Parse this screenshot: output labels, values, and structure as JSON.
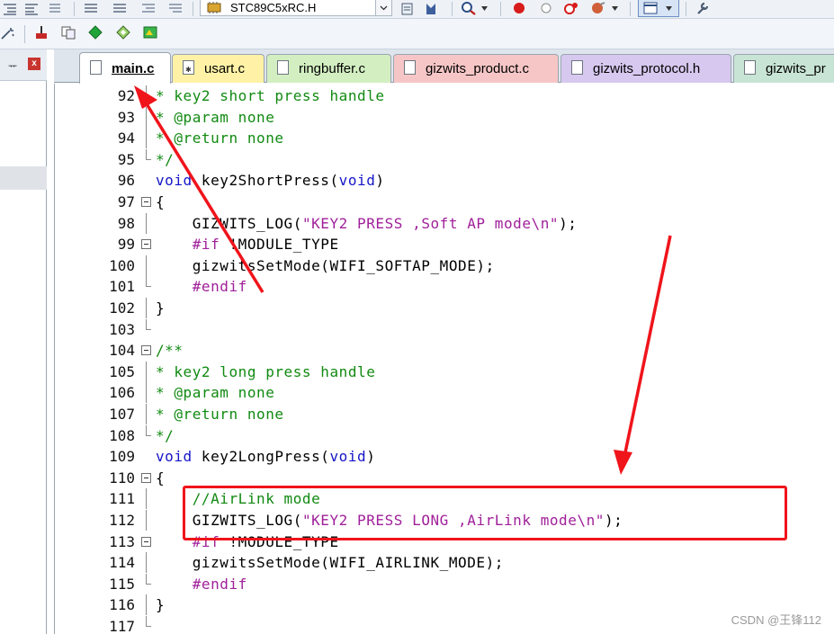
{
  "toolbar": {
    "device": "STC89C5xRC.H"
  },
  "left_panel": {
    "pin_glyph": "ᅲ",
    "close_glyph": "x"
  },
  "tabs": [
    {
      "id": "tab-main",
      "label": "main.c",
      "active": true
    },
    {
      "id": "tab-usart",
      "label": "usart.c",
      "active": false
    },
    {
      "id": "tab-ring",
      "label": "ringbuffer.c",
      "active": false
    },
    {
      "id": "tab-product",
      "label": "gizwits_product.c",
      "active": false
    },
    {
      "id": "tab-protocol",
      "label": "gizwits_protocol.h",
      "active": false
    },
    {
      "id": "tab-gizpr",
      "label": "gizwits_pr",
      "active": false
    }
  ],
  "code_lines": [
    {
      "num": "92",
      "fold": "line",
      "segments": [
        {
          "t": "* key2 short press handle",
          "c": "comment"
        }
      ]
    },
    {
      "num": "93",
      "fold": "line",
      "segments": [
        {
          "t": "* @param none",
          "c": "comment"
        }
      ]
    },
    {
      "num": "94",
      "fold": "line",
      "segments": [
        {
          "t": "* @return none",
          "c": "comment"
        }
      ]
    },
    {
      "num": "95",
      "fold": "end",
      "segments": [
        {
          "t": "*/",
          "c": "comment"
        }
      ]
    },
    {
      "num": "96",
      "fold": "none",
      "segments": [
        {
          "t": "void",
          "c": "keyword"
        },
        {
          "t": " key2ShortPress(",
          "c": "normal"
        },
        {
          "t": "void",
          "c": "keyword"
        },
        {
          "t": ")",
          "c": "normal"
        }
      ]
    },
    {
      "num": "97",
      "fold": "box",
      "segments": [
        {
          "t": "{",
          "c": "normal"
        }
      ]
    },
    {
      "num": "98",
      "fold": "line",
      "segments": [
        {
          "t": "    GIZWITS_LOG(",
          "c": "normal"
        },
        {
          "t": "\"KEY2 PRESS ,Soft AP mode\\n\"",
          "c": "pre"
        },
        {
          "t": ");",
          "c": "normal"
        }
      ]
    },
    {
      "num": "99",
      "fold": "box",
      "segments": [
        {
          "t": "    #if",
          "c": "pre"
        },
        {
          "t": " !MODULE_TYPE",
          "c": "normal"
        }
      ]
    },
    {
      "num": "100",
      "fold": "line",
      "segments": [
        {
          "t": "    gizwitsSetMode(WIFI_SOFTAP_MODE);",
          "c": "normal"
        }
      ]
    },
    {
      "num": "101",
      "fold": "end",
      "segments": [
        {
          "t": "    #endif",
          "c": "pre"
        }
      ]
    },
    {
      "num": "102",
      "fold": "line",
      "segments": [
        {
          "t": "}",
          "c": "normal"
        }
      ]
    },
    {
      "num": "103",
      "fold": "end",
      "segments": [
        {
          "t": "",
          "c": "normal"
        }
      ]
    },
    {
      "num": "104",
      "fold": "box",
      "segments": [
        {
          "t": "/**",
          "c": "comment"
        }
      ]
    },
    {
      "num": "105",
      "fold": "line",
      "segments": [
        {
          "t": "* key2 long press handle",
          "c": "comment"
        }
      ]
    },
    {
      "num": "106",
      "fold": "line",
      "segments": [
        {
          "t": "* @param none",
          "c": "comment"
        }
      ]
    },
    {
      "num": "107",
      "fold": "line",
      "segments": [
        {
          "t": "* @return none",
          "c": "comment"
        }
      ]
    },
    {
      "num": "108",
      "fold": "end",
      "segments": [
        {
          "t": "*/",
          "c": "comment"
        }
      ]
    },
    {
      "num": "109",
      "fold": "none",
      "segments": [
        {
          "t": "void",
          "c": "keyword"
        },
        {
          "t": " key2LongPress(",
          "c": "normal"
        },
        {
          "t": "void",
          "c": "keyword"
        },
        {
          "t": ")",
          "c": "normal"
        }
      ]
    },
    {
      "num": "110",
      "fold": "box",
      "segments": [
        {
          "t": "{",
          "c": "normal"
        }
      ]
    },
    {
      "num": "111",
      "fold": "line",
      "segments": [
        {
          "t": "    //AirLink mode",
          "c": "comment"
        }
      ]
    },
    {
      "num": "112",
      "fold": "line",
      "segments": [
        {
          "t": "    GIZWITS_LOG(",
          "c": "normal"
        },
        {
          "t": "\"KEY2 PRESS LONG ,AirLink mode\\n\"",
          "c": "pre"
        },
        {
          "t": ");",
          "c": "normal"
        }
      ]
    },
    {
      "num": "113",
      "fold": "box",
      "segments": [
        {
          "t": "    #if",
          "c": "pre"
        },
        {
          "t": " !MODULE_TYPE",
          "c": "normal"
        }
      ]
    },
    {
      "num": "114",
      "fold": "line",
      "segments": [
        {
          "t": "    gizwitsSetMode(WIFI_AIRLINK_MODE);",
          "c": "normal"
        }
      ]
    },
    {
      "num": "115",
      "fold": "end",
      "segments": [
        {
          "t": "    #endif",
          "c": "pre"
        }
      ]
    },
    {
      "num": "116",
      "fold": "line",
      "segments": [
        {
          "t": "}",
          "c": "normal"
        }
      ]
    },
    {
      "num": "117",
      "fold": "end",
      "segments": [
        {
          "t": "",
          "c": "normal"
        }
      ]
    }
  ],
  "annotation": {
    "color": "#f0141b"
  },
  "watermark": "CSDN @王锋112"
}
